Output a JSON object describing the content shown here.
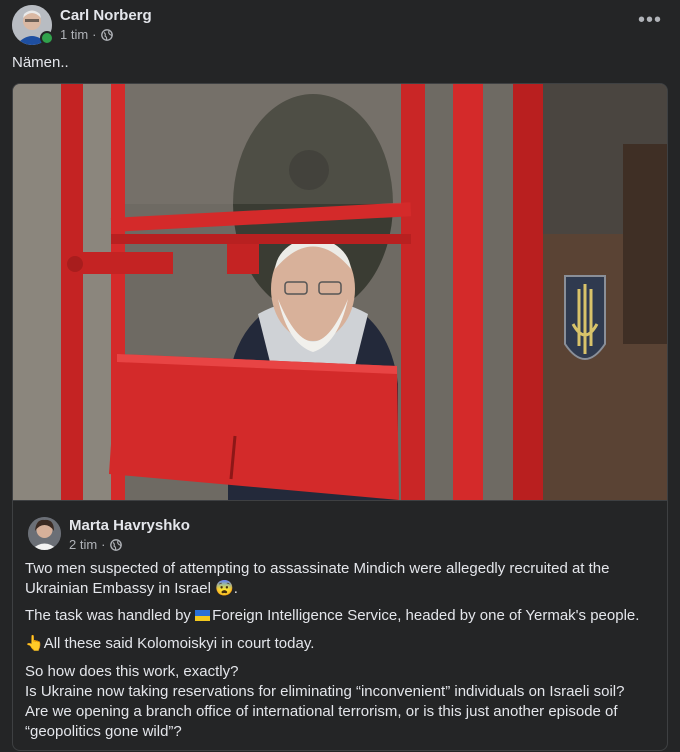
{
  "post": {
    "author": "Carl Norberg",
    "time": "1 tim",
    "separator": "·",
    "text": "Nämen..",
    "more_label": "•••"
  },
  "shared_post": {
    "author": "Marta Havryshko",
    "time": "2 tim",
    "separator": "·",
    "paragraphs": {
      "p1": "Two men suspected of attempting to assassinate Mindich were allegedly recruited at the Ukrainian Embassy in Israel 😨.",
      "p2_text": "Foreign Intelligence Service, headed by one of Yermak's people.",
      "p2_prefix": "The task was handled by ",
      "p3_emoji": "👆",
      "p3_text": "All these said Kolomoiskyi in court today.",
      "p4_line1": "So how does this work, exactly?",
      "p4_line2": "Is Ukraine now taking reservations for eliminating “inconvenient” individuals on Israeli soil?",
      "p4_line3": "Are we opening a branch office of international terrorism, or is this just another episode of “geopolitics gone wild”?"
    }
  },
  "icons": {
    "globe": "globe-icon",
    "more": "more-options-icon",
    "flag": "ukraine-flag-icon"
  },
  "colors": {
    "background": "#242526",
    "text": "#e4e6eb",
    "secondary_text": "#b0b3b8",
    "online": "#31a24c",
    "cage_red": "#d42a2a"
  }
}
